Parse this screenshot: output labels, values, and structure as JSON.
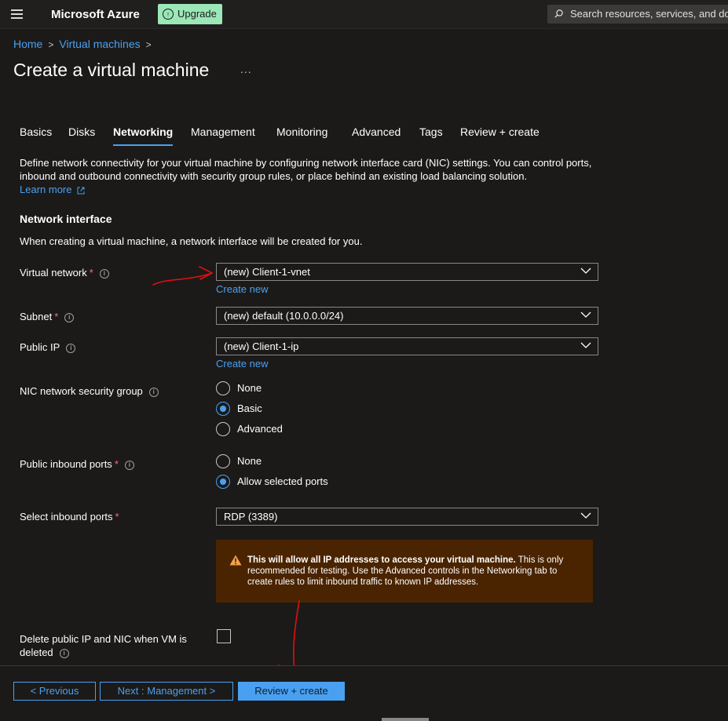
{
  "header": {
    "brand": "Microsoft Azure",
    "upgrade_label": "Upgrade",
    "search_placeholder": "Search resources, services, and docs"
  },
  "breadcrumb": [
    "Home",
    "Virtual machines"
  ],
  "page": {
    "title": "Create a virtual machine",
    "more": "..."
  },
  "tabs": [
    "Basics",
    "Disks",
    "Networking",
    "Management",
    "Monitoring",
    "Advanced",
    "Tags",
    "Review + create"
  ],
  "active_tab": "Networking",
  "intro": {
    "description": "Define network connectivity for your virtual machine by configuring network interface card (NIC) settings. You can control ports, inbound and outbound connectivity with security group rules, or place behind an existing load balancing solution.",
    "learn_more": "Learn more"
  },
  "section": {
    "title": "Network interface",
    "subtitle": "When creating a virtual machine, a network interface will be created for you."
  },
  "fields": {
    "virtual_network": {
      "label": "Virtual network",
      "value": "(new) Client-1-vnet",
      "create_new": "Create new",
      "required": true
    },
    "subnet": {
      "label": "Subnet",
      "value": "(new) default (10.0.0.0/24)",
      "required": true
    },
    "public_ip": {
      "label": "Public IP",
      "value": "(new) Client-1-ip",
      "create_new": "Create new"
    },
    "nic_nsg": {
      "label": "NIC network security group",
      "options": [
        "None",
        "Basic",
        "Advanced"
      ],
      "selected": "Basic"
    },
    "public_inbound_ports": {
      "label": "Public inbound ports",
      "options": [
        "None",
        "Allow selected ports"
      ],
      "selected": "Allow selected ports",
      "required": true
    },
    "select_inbound_ports": {
      "label": "Select inbound ports",
      "value": "RDP (3389)",
      "required": true
    },
    "delete_public_ip": {
      "label": "Delete public IP and NIC when VM is deleted",
      "checked": false
    }
  },
  "warning": {
    "bold": "This will allow all IP addresses to access your virtual machine.",
    "text": "This is only recommended for testing.  Use the Advanced controls in the Networking tab to create rules to limit inbound traffic to known IP addresses."
  },
  "footer": {
    "previous": "< Previous",
    "next": "Next : Management >",
    "review": "Review + create"
  },
  "colors": {
    "accent": "#4aa0f0",
    "required": "#f1707b",
    "warning_bg": "#4a2400",
    "annotation": "#e01010"
  }
}
